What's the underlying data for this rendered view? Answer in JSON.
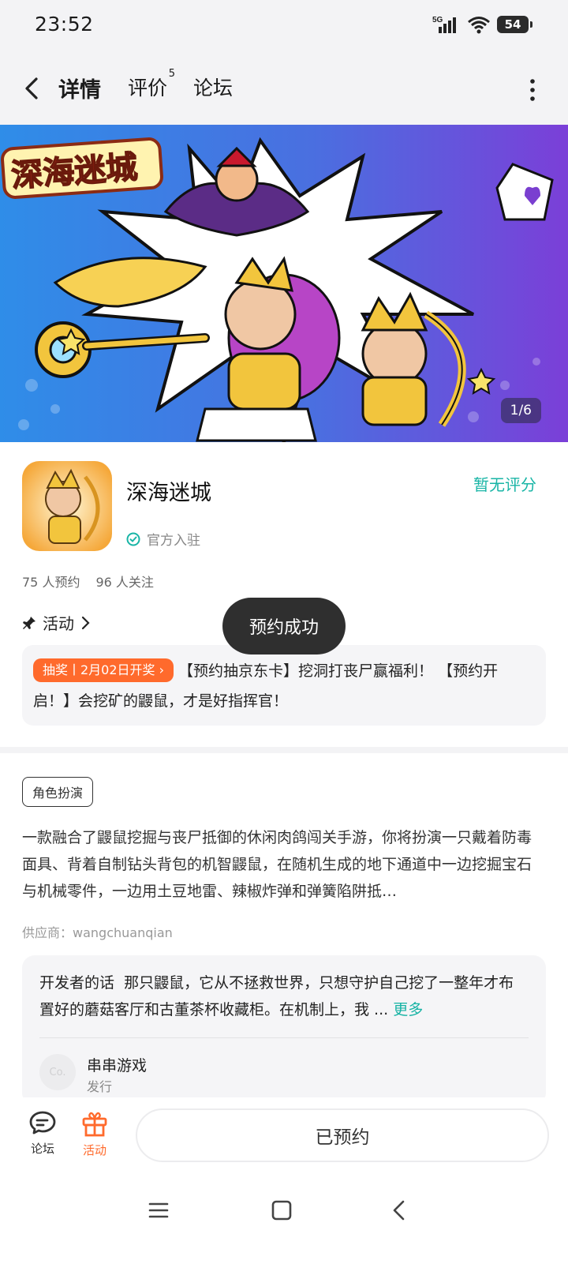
{
  "status_bar": {
    "time": "23:52",
    "network": "5G",
    "battery": "54"
  },
  "nav": {
    "tabs": [
      {
        "label": "详情",
        "active": true
      },
      {
        "label": "评价",
        "badge": "5"
      },
      {
        "label": "论坛"
      }
    ]
  },
  "banner": {
    "title_art": "深海迷城",
    "page_indicator": "1/6"
  },
  "app": {
    "name": "深海迷城",
    "rating_text": "暂无评分",
    "official_label": "官方入驻",
    "reservations": "75 人预约",
    "followers": "96 人关注",
    "activity_label": "活动"
  },
  "toast": "预约成功",
  "event": {
    "tag": "抽奖丨2月02日开奖",
    "text": "【预约抽京东卡】挖洞打丧尸赢福利！ 【预约开启！】会挖矿的鼹鼠，才是好指挥官！"
  },
  "description": {
    "genre_tag": "角色扮演",
    "text": "一款融合了鼹鼠挖掘与丧尸抵御的休闲肉鸽闯关手游，你将扮演一只戴着防毒面具、背着自制钻头背包的机智鼹鼠，在随机生成的地下通道中一边挖掘宝石与机械零件，一边用土豆地雷、辣椒炸弹和弹簧陷阱抵…",
    "supplier": "供应商：wangchuanqian"
  },
  "developer": {
    "label": "开发者的话",
    "text": "那只鼹鼠，它从不拯救世界，只想守护自己挖了一整年才布置好的蘑菇客厅和古董茶杯收藏柜。在机制上，我 ...",
    "more": "更多",
    "publisher_name": "串串游戏",
    "publisher_role": "发行",
    "avatar_text": "Co."
  },
  "bottom_bar": {
    "forum_label": "论坛",
    "activity_label": "活动",
    "reserve_button": "已预约"
  },
  "colors": {
    "accent": "#12c2b0",
    "orange": "#ff6a2c"
  }
}
